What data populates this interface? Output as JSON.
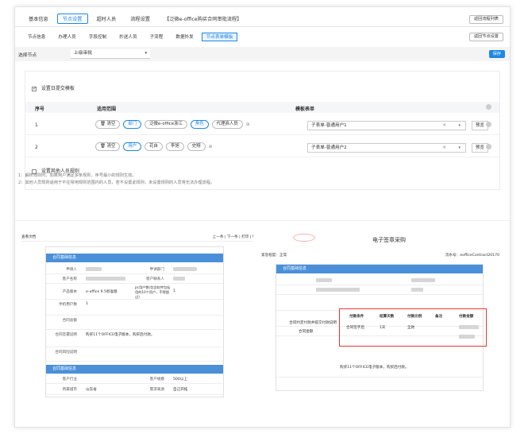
{
  "top_tabs": [
    "基本信息",
    "节点设置",
    "超时人员",
    "流程设置",
    "【泛微e-office购买合同审批流程】"
  ],
  "top_active": 1,
  "return_list_label": "返回流程列表",
  "sub_tabs": [
    "节点信息",
    "办理人员",
    "字段控制",
    "抄送人员",
    "子流程",
    "数据外发",
    "节点表单模板"
  ],
  "sub_active": 6,
  "return_node_label": "返回节点设置",
  "node_label": "选择节点",
  "node_value": "上级审批",
  "save_label": "保存",
  "set_submit_template_label": "设置日提交模板",
  "table_headers": {
    "index": "序号",
    "scope": "适用范围",
    "form": "模板表单"
  },
  "rows": [
    {
      "index": "1",
      "clear": "清空",
      "chips": [
        "部门",
        "泛微e-office浙江",
        "角色",
        "代理商人员"
      ],
      "form": "子表单-普通用户1",
      "preview": "预览"
    },
    {
      "index": "2",
      "clear": "清空",
      "chips": [
        "用户",
        "花自",
        "李旭",
        "史翔"
      ],
      "form": "子表单-普通用户2",
      "preview": "预览"
    }
  ],
  "other_rules_label": "设置其他人员规则",
  "notes": [
    "1：解析规则时，如果用户满足多条规则，序号最小的规则生效。",
    "2：其他人员规则适用于不在常用规则范围内的人员，若不设置此规则，未设置规则的人员将无法办理流程。"
  ],
  "left_shot": {
    "head_right": "上一条 | 下一条 | 打印 | 导出",
    "head_left": "查看文档",
    "section1": "合同基础信息",
    "fields": [
      {
        "k": "申请人",
        "k2": "申请部门"
      },
      {
        "k": "客户名称",
        "k2": "客户联系人"
      },
      {
        "k": "产品版本",
        "v": "e-office 9.5标准版",
        "k2": "pc用户数(包含软件包括用的10个用户，不得超过)",
        "v2": "1"
      },
      {
        "k": "手机用户数",
        "v": "1"
      },
      {
        "k": "合同总额"
      },
      {
        "k": "合同签署说明",
        "v": "购买11个OFFICE电子版本，购买后付款。"
      },
      {
        "k": "合同风险说明"
      }
    ],
    "section2": "合同基础信息",
    "fields2": [
      {
        "k": "客户行业",
        "k2": "客户规模",
        "v2": "500以上"
      },
      {
        "k": "所属城市",
        "v": "山东省",
        "k2": "需求来源",
        "v2": "自己开拓"
      }
    ]
  },
  "right_shot": {
    "title": "电子签章采购",
    "top_left": "紧急程度：正常",
    "top_right": "流水号：eofficeContract20170",
    "section1": "合同基础信息",
    "payment_label": "合同约定付款并提交付款说明",
    "payment_headers": [
      "付款条件",
      "结算天数",
      "付款比例",
      "备注",
      "付款金额"
    ],
    "payment_row": [
      "合同签字后",
      "1天",
      "全款",
      "",
      ""
    ],
    "contract_total_label": "合同金额",
    "sign_note": "购买11个OFFICE电子版本，购买后付款。"
  }
}
